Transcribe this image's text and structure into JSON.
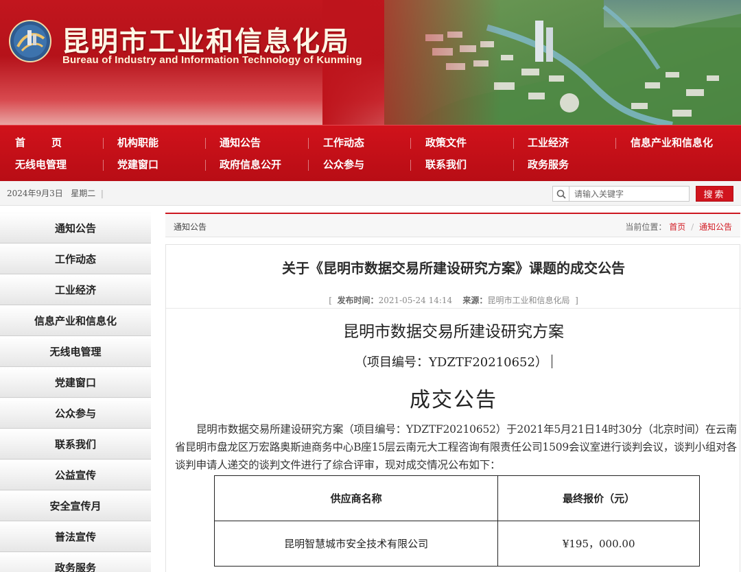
{
  "header": {
    "title": "昆明市工业和信息化局",
    "subtitle": "Bureau of Industry and Information Technology of Kunming"
  },
  "nav": {
    "row1": [
      "首页",
      "机构职能",
      "通知公告",
      "工作动态",
      "政策文件",
      "工业经济",
      "信息产业和信息化"
    ],
    "row2": [
      "无线电管理",
      "党建窗口",
      "政府信息公开",
      "公众参与",
      "联系我们",
      "政务服务"
    ]
  },
  "datebar": {
    "date": "2024年9月3日",
    "weekday": "星期二",
    "divider": "|",
    "search_placeholder": "请输入关键字",
    "search_button": "搜索"
  },
  "sidebar": {
    "items": [
      "通知公告",
      "工作动态",
      "工业经济",
      "信息产业和信息化",
      "无线电管理",
      "党建窗口",
      "公众参与",
      "联系我们",
      "公益宣传",
      "安全宣传月",
      "普法宣传",
      "政务服务"
    ]
  },
  "content_header": {
    "section": "通知公告",
    "location_label": "当前位置：",
    "crumb_home": "首页",
    "crumb_sep": "/",
    "crumb_current": "通知公告"
  },
  "article": {
    "title": "关于《昆明市数据交易所建设研究方案》课题的成交公告",
    "meta_open": "[",
    "publish_label": "发布时间：",
    "publish_time": "2021-05-24 14:14",
    "source_label": "来源：",
    "source": "昆明市工业和信息化局",
    "meta_close": "]",
    "doc_title": "昆明市数据交易所建设研究方案",
    "project_no": "（项目编号：YDZTF20210652）",
    "notice_title": "成交公告",
    "body": "昆明市数据交易所建设研究方案（项目编号：YDZTF20210652）于2021年5月21日14时30分（北京时间）在云南省昆明市盘龙区万宏路奥斯迪商务中心B座15层云南元大工程咨询有限责任公司1509会议室进行谈判会议，谈判小组对各谈判申请人递交的谈判文件进行了综合评审，现对成交情况公布如下：",
    "table": {
      "headers": [
        "供应商名称",
        "最终报价（元）"
      ],
      "rows": [
        [
          "昆明智慧城市安全技术有限公司",
          "¥195，000.00"
        ]
      ]
    }
  },
  "colors": {
    "brand_red": "#c2161e",
    "nav_red": "#c4101a",
    "accent_red": "#d21a22"
  }
}
